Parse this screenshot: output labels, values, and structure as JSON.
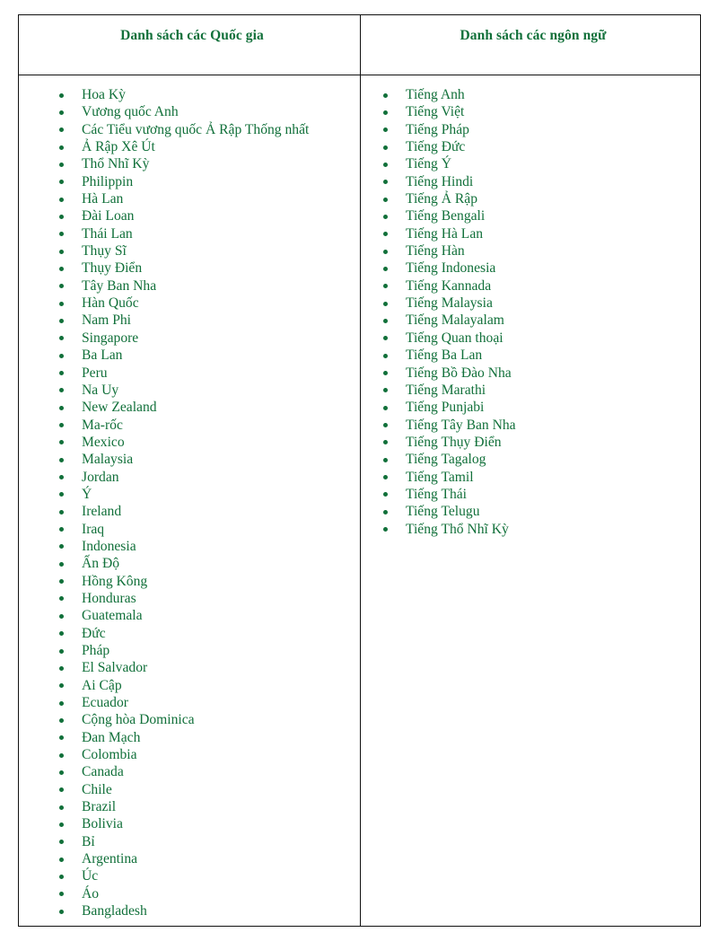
{
  "table": {
    "columns": [
      {
        "header": "Danh sách các Quốc gia",
        "items": [
          "Hoa Kỳ",
          "Vương quốc Anh",
          "Các Tiểu vương quốc Ả Rập Thống nhất",
          "Ả Rập Xê Út",
          "Thổ Nhĩ Kỳ",
          "Philippin",
          "Hà Lan",
          "Đài Loan",
          "Thái Lan",
          "Thụy Sĩ",
          "Thụy Điển",
          "Tây Ban Nha",
          "Hàn Quốc",
          "Nam Phi",
          "Singapore",
          "Ba Lan",
          "Peru",
          "Na Uy",
          "New Zealand",
          "Ma-rốc",
          "Mexico",
          "Malaysia",
          "Jordan",
          "Ý",
          "Ireland",
          "Iraq",
          "Indonesia",
          "Ấn Độ",
          "Hồng Kông",
          "Honduras",
          "Guatemala",
          "Đức",
          "Pháp",
          "El Salvador",
          "Ai Cập",
          "Ecuador",
          "Cộng hòa Dominica",
          "Đan Mạch",
          "Colombia",
          "Canada",
          "Chile",
          "Brazil",
          "Bolivia",
          "Bỉ",
          "Argentina",
          "Úc",
          "Áo",
          "Bangladesh"
        ]
      },
      {
        "header": "Danh sách các ngôn ngữ",
        "items": [
          "Tiếng Anh",
          "Tiếng Việt",
          "Tiếng Pháp",
          "Tiếng Đức",
          "Tiếng Ý",
          "Tiếng Hindi",
          "Tiếng Ả Rập",
          "Tiếng Bengali",
          "Tiếng Hà Lan",
          "Tiếng Hàn",
          "Tiếng Indonesia",
          "Tiếng Kannada",
          "Tiếng Malaysia",
          "Tiếng Malayalam",
          "Tiếng Quan thoại",
          "Tiếng Ba Lan",
          "Tiếng Bồ Đào Nha",
          "Tiếng Marathi",
          "Tiếng Punjabi",
          "Tiếng Tây Ban Nha",
          "Tiếng Thụy Điển",
          "Tiếng Tagalog",
          "Tiếng Tamil",
          "Tiếng Thái",
          "Tiếng Telugu",
          "Tiếng Thổ Nhĩ Kỳ"
        ]
      }
    ]
  },
  "colors": {
    "text_green": "#11703a",
    "border": "#111111",
    "background": "#ffffff"
  }
}
